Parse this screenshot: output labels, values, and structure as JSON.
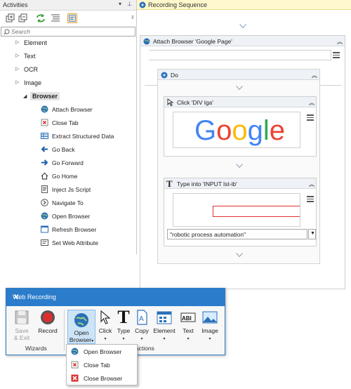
{
  "activities": {
    "title": "Activities",
    "search_placeholder": "Search",
    "categories": [
      "Element",
      "Text",
      "OCR",
      "Image"
    ],
    "browser_label": "Browser",
    "browser_items": [
      "Attach Browser",
      "Close Tab",
      "Extract Structured Data",
      "Go Back",
      "Go Forward",
      "Go Home",
      "Inject Js Script",
      "Navigate To",
      "Open Browser",
      "Refresh Browser",
      "Set Web Attribute"
    ]
  },
  "recording": {
    "tab_title": "Recording Sequence",
    "attach_title": "Attach Browser 'Google Page'",
    "do_title": "Do",
    "click_title": "Click 'DIV  lga'",
    "google_letters": [
      "G",
      "o",
      "o",
      "g",
      "l",
      "e"
    ],
    "type_title": "Type into 'INPUT  lst-ib'",
    "type_value": "\"robotic process automation\""
  },
  "web_recording": {
    "title": "Web Recording",
    "save_exit": [
      "Save",
      "& Exit"
    ],
    "record": "Record",
    "open_browser": [
      "Open",
      "Browser"
    ],
    "click": "Click",
    "type": "Type",
    "copy": "Copy",
    "element": "Element",
    "text": "Text",
    "image": "Image",
    "group_wizards": "Wizards",
    "group_actions": "Actions",
    "dropdown": [
      "Open Browser",
      "Close Tab",
      "Close Browser"
    ]
  },
  "colors": {
    "accent_blue": "#2b7ccb",
    "google_blue": "#4285F4",
    "google_red": "#EA4335",
    "google_yellow": "#FBBC05",
    "google_green": "#34A853",
    "record_red": "#d9302f"
  }
}
